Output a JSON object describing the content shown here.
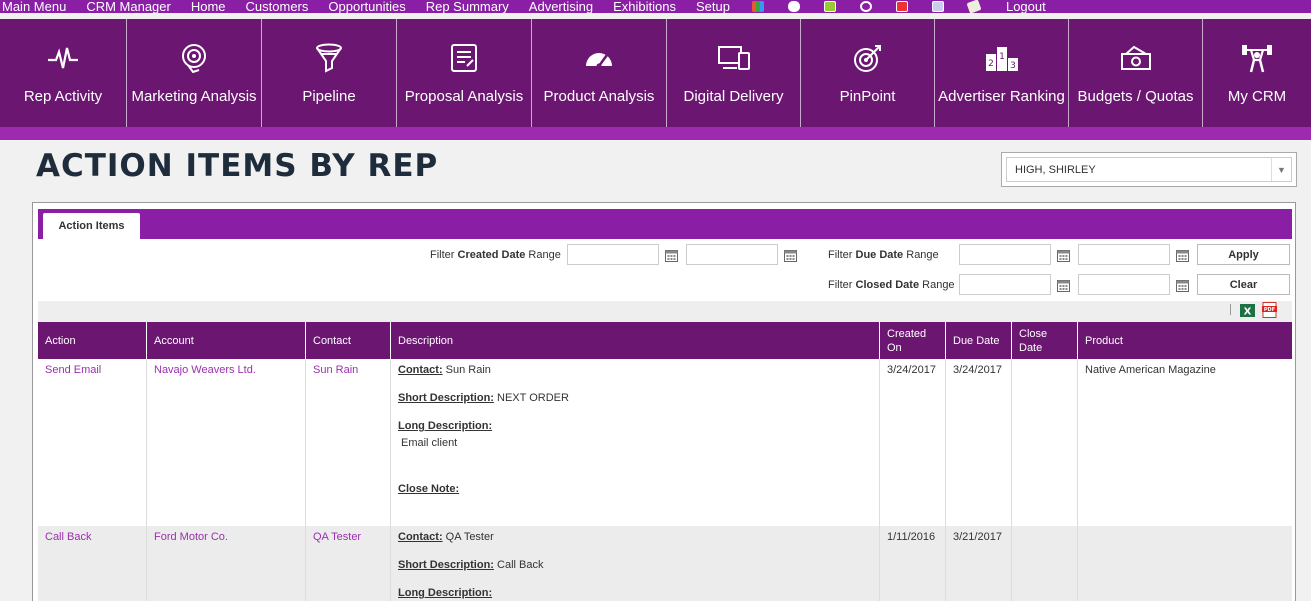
{
  "top_menu": [
    {
      "label": "Main Menu"
    },
    {
      "label": "CRM Manager"
    },
    {
      "label": "Home"
    },
    {
      "label": "Customers"
    },
    {
      "label": "Opportunities"
    },
    {
      "label": "Rep Summary"
    },
    {
      "label": "Advertising"
    },
    {
      "label": "Exhibitions"
    },
    {
      "label": "Setup"
    },
    {
      "label": "Logout"
    }
  ],
  "top_icons": [
    "apps-icon",
    "chat-icon",
    "media-icon",
    "info-icon",
    "mail-icon",
    "card-icon",
    "edit-icon"
  ],
  "nav_tiles": [
    {
      "label": "Rep Activity",
      "icon": "pulse-icon"
    },
    {
      "label": "Marketing Analysis",
      "icon": "target-hand-icon"
    },
    {
      "label": "Pipeline",
      "icon": "funnel-icon"
    },
    {
      "label": "Proposal Analysis",
      "icon": "document-icon"
    },
    {
      "label": "Product Analysis",
      "icon": "gauge-icon"
    },
    {
      "label": "Digital Delivery",
      "icon": "devices-icon"
    },
    {
      "label": "PinPoint",
      "icon": "bullseye-icon"
    },
    {
      "label": "Advertiser Ranking",
      "icon": "podium-icon"
    },
    {
      "label": "Budgets / Quotas",
      "icon": "money-icon"
    },
    {
      "label": "My CRM",
      "icon": "weightlifter-icon"
    }
  ],
  "page": {
    "title": "ACTION ITEMS BY REP",
    "rep_selected": "HIGH, SHIRLEY"
  },
  "tabs": [
    {
      "label": "Action Items"
    }
  ],
  "filters": {
    "created_prefix": "Filter ",
    "created_bold": "Created Date",
    "created_suffix": " Range",
    "due_prefix": "Filter ",
    "due_bold": "Due Date",
    "due_suffix": " Range",
    "closed_prefix": "Filter ",
    "closed_bold": "Closed Date",
    "closed_suffix": " Range",
    "apply_label": "Apply",
    "clear_label": "Clear"
  },
  "table": {
    "columns": [
      "Action",
      "Account",
      "Contact",
      "Description",
      "Created On",
      "Due Date",
      "Close Date",
      "Product"
    ],
    "rows": [
      {
        "action": "Send Email",
        "account": "Navajo Weavers Ltd.",
        "contact": "Sun Rain",
        "contact_label": "Contact:",
        "contact_value": "Sun Rain",
        "short_label": "Short Description:",
        "short_value": "NEXT ORDER",
        "long_label": "Long Description:",
        "long_value": "Email client",
        "close_label": "Close Note:",
        "created_on": "3/24/2017",
        "due_date": "3/24/2017",
        "close_date": "",
        "product": "Native American Magazine"
      },
      {
        "action": "Call Back",
        "account": "Ford Motor Co.",
        "contact": "QA Tester",
        "contact_label": "Contact:",
        "contact_value": "QA Tester",
        "short_label": "Short Description:",
        "short_value": "Call Back",
        "long_label": "Long Description:",
        "long_value": "",
        "close_label": "",
        "created_on": "1/11/2016",
        "due_date": "3/21/2017",
        "close_date": "",
        "product": ""
      }
    ]
  }
}
